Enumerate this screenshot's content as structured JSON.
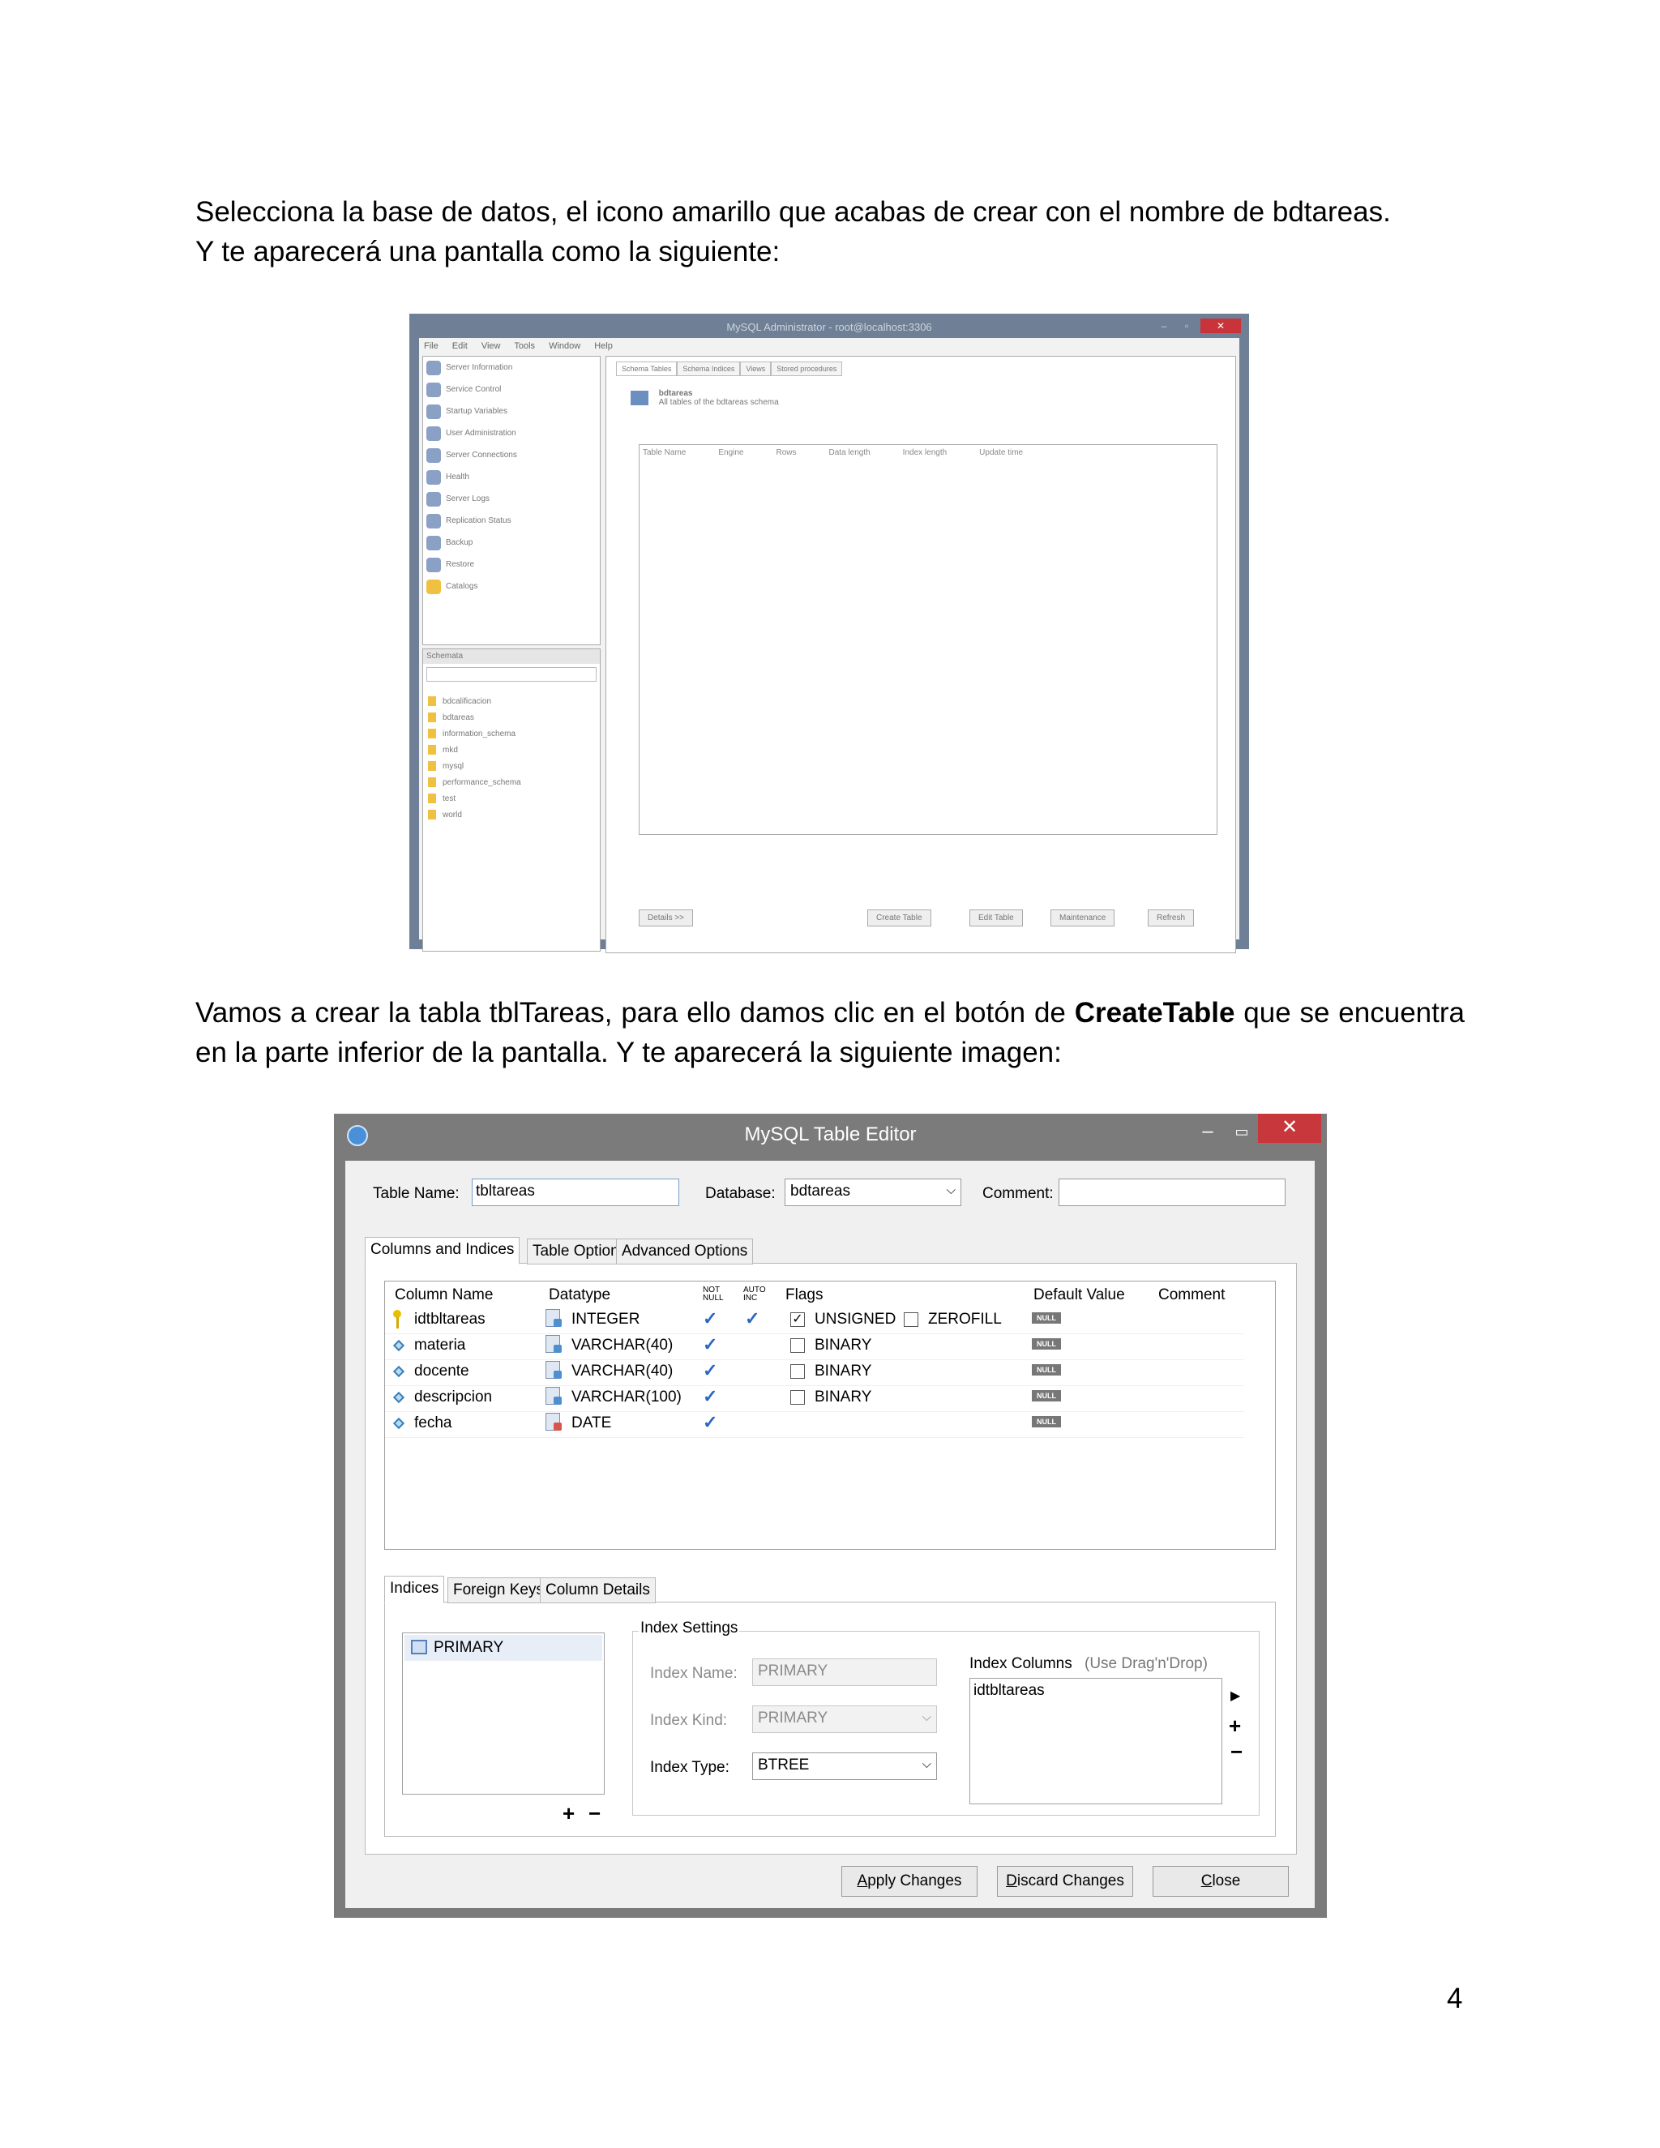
{
  "doc": {
    "p1_line1": "Selecciona la base de datos, el icono amarillo que acabas de crear con el nombre de bdtareas.",
    "p1_line2": "Y te aparecerá una pantalla como la siguiente:",
    "p2_a": "Vamos a crear la tabla tblTareas, para ello damos clic en el botón de ",
    "p2_bold": "CreateTable",
    "p2_b": " que se encuentra en la parte inferior de la pantalla. Y te aparecerá la siguiente imagen:",
    "page_number": "4"
  },
  "admin": {
    "title": "MySQL Administrator - root@localhost:3306",
    "menu": [
      "File",
      "Edit",
      "View",
      "Tools",
      "Window",
      "Help"
    ],
    "nav": [
      "Server Information",
      "Service Control",
      "Startup Variables",
      "User Administration",
      "Server Connections",
      "Health",
      "Server Logs",
      "Replication Status",
      "Backup",
      "Restore",
      "Catalogs"
    ],
    "schemata_label": "Schemata",
    "schemas": [
      "bdcalificacion",
      "bdtareas",
      "information_schema",
      "mkd",
      "mysql",
      "performance_schema",
      "test",
      "world"
    ],
    "tabs": [
      "Schema Tables",
      "Schema Indices",
      "Views",
      "Stored procedures"
    ],
    "schema_name": "bdtareas",
    "schema_desc": "All tables of the bdtareas schema",
    "columns": [
      "Table Name",
      "Engine",
      "Rows",
      "Data length",
      "Index length",
      "Update time"
    ],
    "buttons": [
      "Details >>",
      "Create Table",
      "Edit Table",
      "Maintenance",
      "Refresh"
    ]
  },
  "editor": {
    "title": "MySQL Table Editor",
    "table_name_label": "Table Name:",
    "table_name_value": "tbltareas",
    "database_label": "Database:",
    "database_value": "bdtareas",
    "comment_label": "Comment:",
    "comment_value": "",
    "tabs": [
      "Columns and Indices",
      "Table Options",
      "Advanced Options"
    ],
    "grid_headers": {
      "column_name": "Column Name",
      "datatype": "Datatype",
      "not_null": "NOT NULL",
      "auto_inc": "AUTO INC",
      "flags": "Flags",
      "default_value": "Default Value",
      "comment": "Comment"
    },
    "rows": [
      {
        "name": "idtbltareas",
        "datatype": "INTEGER",
        "flag1": "UNSIGNED",
        "flag2": "ZEROFILL",
        "default": "NULL"
      },
      {
        "name": "materia",
        "datatype": "VARCHAR(40)",
        "flag1": "BINARY",
        "default": "NULL"
      },
      {
        "name": "docente",
        "datatype": "VARCHAR(40)",
        "flag1": "BINARY",
        "default": "NULL"
      },
      {
        "name": "descripcion",
        "datatype": "VARCHAR(100)",
        "flag1": "BINARY",
        "default": "NULL"
      },
      {
        "name": "fecha",
        "datatype": "DATE",
        "default": "NULL"
      }
    ],
    "lower_tabs": [
      "Indices",
      "Foreign Keys",
      "Column Details"
    ],
    "index_item": "PRIMARY",
    "index_settings_label": "Index Settings",
    "index_name_label": "Index Name:",
    "index_name_value": "PRIMARY",
    "index_kind_label": "Index Kind:",
    "index_kind_value": "PRIMARY",
    "index_type_label": "Index Type:",
    "index_type_value": "BTREE",
    "index_columns_label": "Index Columns",
    "index_columns_hint": "(Use Drag'n'Drop)",
    "index_column_item": "idtbltareas",
    "plus": "+",
    "minus": "−",
    "apply_first": "A",
    "apply_rest": "pply Changes",
    "discard_first": "D",
    "discard_rest": "iscard Changes",
    "close_first": "C",
    "close_rest": "lose"
  }
}
